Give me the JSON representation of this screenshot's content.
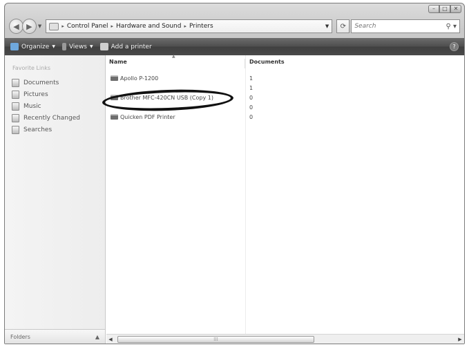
{
  "address": {
    "crumbs": [
      "Control Panel",
      "Hardware and Sound",
      "Printers"
    ],
    "refresh_glyph": "⁴⁺ⱼ"
  },
  "search": {
    "placeholder": "Search"
  },
  "toolbar": {
    "organize_label": "Organize",
    "views_label": "Views",
    "add_printer_label": "Add a printer"
  },
  "nav_pane": {
    "title": "Favorite Links",
    "items": [
      {
        "label": "Documents",
        "icon": "documents-icon"
      },
      {
        "label": "Pictures",
        "icon": "pictures-icon"
      },
      {
        "label": "Music",
        "icon": "music-icon"
      },
      {
        "label": "Recently Changed",
        "icon": "recent-icon"
      },
      {
        "label": "Searches",
        "icon": "searches-icon"
      }
    ],
    "folders_label": "Folders"
  },
  "columns": {
    "name": "Name",
    "documents": "Documents"
  },
  "printers": [
    {
      "name": "Apollo P-1200",
      "documents": "1"
    },
    {
      "name": "",
      "documents": "1"
    },
    {
      "name": "Brother MFC-420CN USB (Copy 1)",
      "documents": "0"
    },
    {
      "name": "",
      "documents": "0"
    },
    {
      "name": "Quicken PDF Printer",
      "documents": "0"
    }
  ],
  "colors": {
    "toolbar": "#4d4d4d",
    "nav_pane": "#f0f0f0",
    "annotation": "#111111"
  }
}
